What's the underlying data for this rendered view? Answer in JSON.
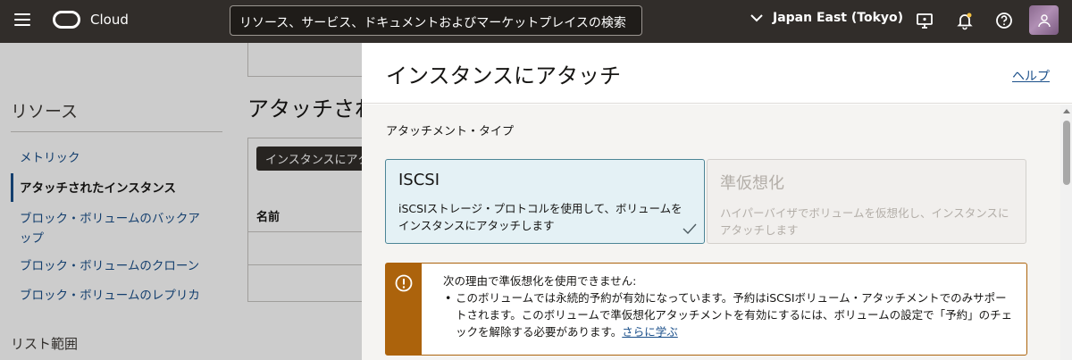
{
  "header": {
    "brand": "Cloud",
    "search_placeholder": "リソース、サービス、ドキュメントおよびマーケットプレイスの検索",
    "region": "Japan East (Tokyo)",
    "icons": [
      "menu-icon",
      "oracle-logo",
      "chevron-down-icon",
      "monitor-icon",
      "bell-icon",
      "help-icon",
      "avatar"
    ]
  },
  "sidebar": {
    "resources_title": "リソース",
    "items": [
      {
        "label": "メトリック"
      },
      {
        "label": "アタッチされたインスタンス",
        "active": true
      },
      {
        "label": "ブロック・ボリュームのバックアップ"
      },
      {
        "label": "ブロック・ボリュームのクローン"
      },
      {
        "label": "ブロック・ボリュームのレプリカ"
      }
    ],
    "list_scope_title": "リスト範囲"
  },
  "main": {
    "title": "アタッチされたインスタンス",
    "attach_button": "インスタンスにアタッチ",
    "table_header_name": "名前"
  },
  "drawer": {
    "title": "インスタンスにアタッチ",
    "help_link": "ヘルプ",
    "attachment_type_label": "アタッチメント・タイプ",
    "options": [
      {
        "title": "ISCSI",
        "description": "iSCSIストレージ・プロトコルを使用して、ボリュームをインスタンスにアタッチします",
        "selected": true
      },
      {
        "title": "準仮想化",
        "description": "ハイパーバイザでボリュームを仮想化し、インスタンスにアタッチします",
        "disabled": true
      }
    ],
    "warning": {
      "heading": "次の理由で準仮想化を使用できません:",
      "bullet": "このボリュームでは永続的予約が有効になっています。予約はiSCSIボリューム・アタッチメントでのみサポートされます。このボリュームで準仮想化アタッチメントを有効にするには、ボリュームの設定で「予約」のチェックを解除する必要があります。",
      "link_text": "さらに学ぶ",
      "icon": "warning-icon"
    }
  },
  "colors": {
    "header_bg": "#312d2a",
    "link": "#1a4f8a",
    "selected_tile_bg": "#e4f1f5",
    "selected_tile_border": "#4c8596",
    "warning": "#ac630c"
  }
}
